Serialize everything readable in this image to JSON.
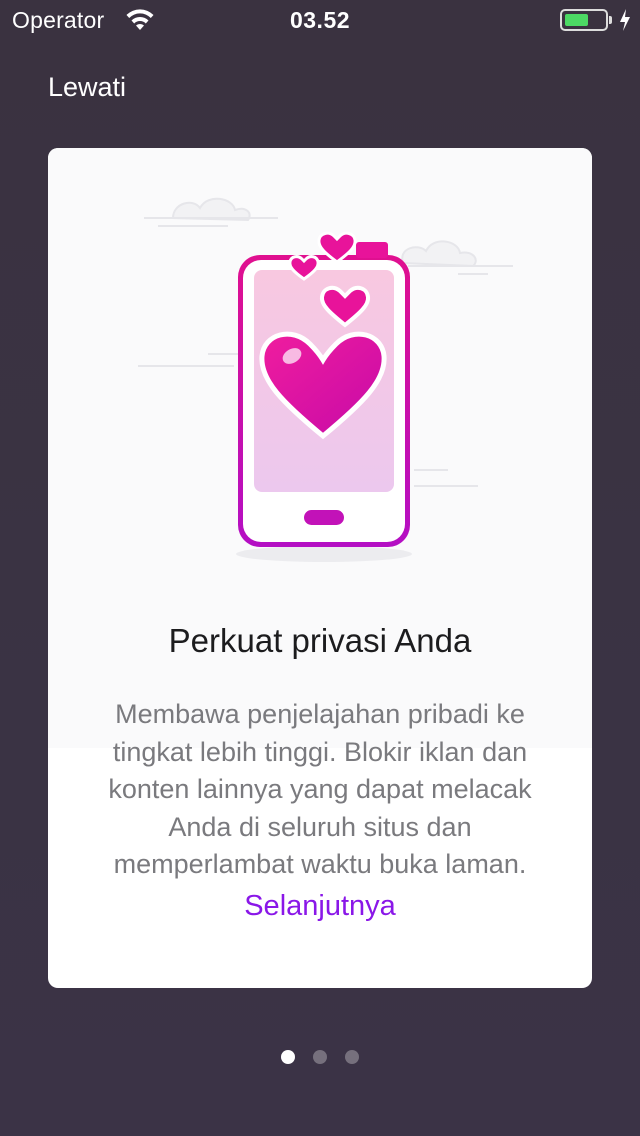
{
  "status_bar": {
    "carrier": "Operator",
    "time": "03.52",
    "battery_level": 0.6,
    "icons": [
      "wifi-icon",
      "battery-icon",
      "charging-bolt-icon"
    ]
  },
  "header": {
    "skip_label": "Lewati"
  },
  "card": {
    "illustration": "phone-with-hearts",
    "title": "Perkuat privasi Anda",
    "body": "Membawa penjelajahan pribadi ke tingkat lebih tinggi. Blokir iklan dan konten lainnya yang dapat melacak Anda di seluruh situs dan memperlambat waktu buka laman.",
    "next_label": "Selanjutnya"
  },
  "pager": {
    "total": 3,
    "current": 1
  },
  "colors": {
    "accent": "#8a17e8",
    "background": "#3a3343",
    "heart_pink": "#e8139a",
    "phone_magenta": "#c212b8",
    "battery_green": "#4cd964"
  }
}
